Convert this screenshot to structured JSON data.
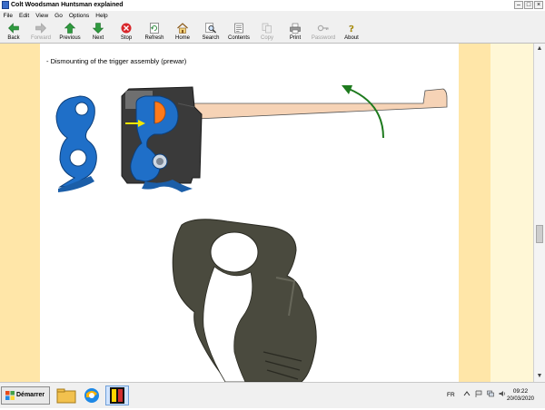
{
  "window": {
    "title": "Colt Woodsman Huntsman explained"
  },
  "menu": [
    "File",
    "Edit",
    "View",
    "Go",
    "Options",
    "Help"
  ],
  "toolbar": [
    {
      "label": "Back",
      "icon": "back-arrow-icon",
      "enabled": true
    },
    {
      "label": "Forward",
      "icon": "forward-arrow-icon",
      "enabled": false
    },
    {
      "label": "Previous",
      "icon": "up-arrow-icon",
      "enabled": true
    },
    {
      "label": "Next",
      "icon": "down-arrow-icon",
      "enabled": true
    },
    {
      "label": "Stop",
      "icon": "stop-icon",
      "enabled": true
    },
    {
      "label": "Refresh",
      "icon": "refresh-icon",
      "enabled": true
    },
    {
      "label": "Home",
      "icon": "home-icon",
      "enabled": true
    },
    {
      "label": "Search",
      "icon": "search-icon",
      "enabled": true
    },
    {
      "label": "Contents",
      "icon": "contents-icon",
      "enabled": true
    },
    {
      "label": "Copy",
      "icon": "copy-icon",
      "enabled": false
    },
    {
      "label": "Print",
      "icon": "print-icon",
      "enabled": true
    },
    {
      "label": "Password",
      "icon": "key-icon",
      "enabled": false
    },
    {
      "label": "About",
      "icon": "about-icon",
      "enabled": true
    }
  ],
  "content": {
    "heading": "- Dismounting of the trigger assembly (prewar)"
  },
  "taskbar": {
    "start_label": "Démarrer",
    "language": "FR",
    "time": "09:22",
    "date": "20/03/2020"
  },
  "colors": {
    "page_margin": "#ffe6a8",
    "diagram_blue": "#1f6fc8",
    "diagram_orange": "#ff7a1a",
    "arrow_green": "#1e7a1e",
    "arrow_yellow": "#f2e600",
    "bar_fill": "#f6d3b6"
  }
}
